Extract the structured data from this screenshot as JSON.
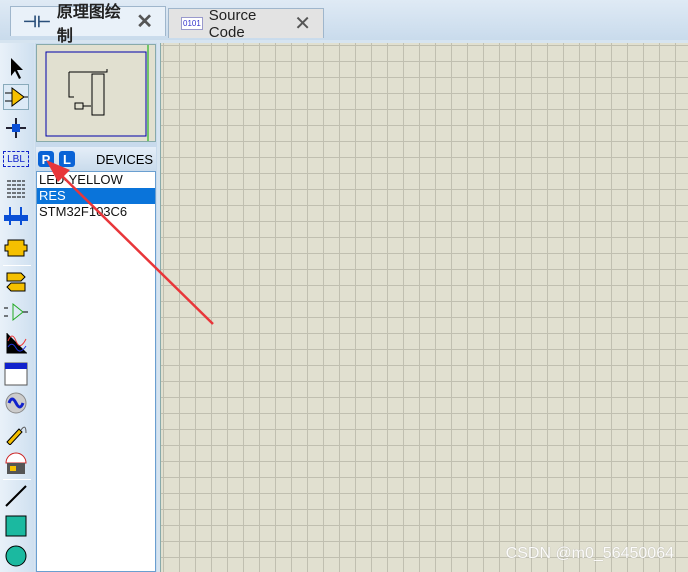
{
  "tabs": [
    {
      "label": "原理图绘制",
      "close": "✕"
    },
    {
      "label": "Source Code",
      "close": "✕"
    }
  ],
  "device_panel": {
    "p_button": "P",
    "l_button": "L",
    "title": "DEVICES",
    "items": [
      "LED-YELLOW",
      "RES",
      "STM32F103C6"
    ],
    "selected": "RES"
  },
  "watermark": "CSDN @m0_56450064",
  "colors": {
    "accent": "#0a74da",
    "canvas": "#e1e0d0",
    "arrow": "#e8363a"
  }
}
